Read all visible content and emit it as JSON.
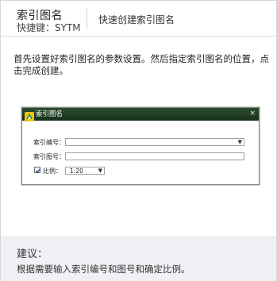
{
  "header": {
    "command_title": "索引图名",
    "shortcut": "快捷键：SYTM",
    "description": "快速创建索引图名"
  },
  "intro": {
    "text": "首先设置好索引图名的参数设置。然后指定索引图名的位置，点击完成创建。"
  },
  "dialog": {
    "title": "索引图名",
    "close_glyph": "×",
    "index_number_label": "索引编号：",
    "index_number_value": "",
    "index_drawing_label": "索引图号：",
    "index_drawing_value": "",
    "scale_checkbox_checked": true,
    "scale_label": "比例：",
    "scale_value": "1:20"
  },
  "advice": {
    "title": "建议：",
    "text": "根据需要输入索引编号和图号和确定比例。"
  },
  "colors": {
    "titlebar": "#1f3a22",
    "advice_bg": "#eff1f4"
  }
}
